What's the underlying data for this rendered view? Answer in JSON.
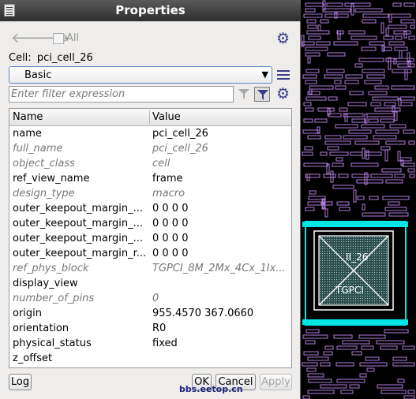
{
  "window": {
    "title": "Properties"
  },
  "toolbar": {
    "back_icon": "arrow-left-icon",
    "forward_icon": "arrow-right-icon",
    "all_label": "All",
    "all_checked": false,
    "settings_icon": "gear-icon"
  },
  "cell": {
    "label": "Cell:",
    "name": "pci_cell_26"
  },
  "view_select": {
    "value": "Basic"
  },
  "filter": {
    "placeholder": "Enter filter expression",
    "value": ""
  },
  "table": {
    "headers": {
      "name": "Name",
      "value": "Value"
    },
    "rows": [
      {
        "name": "name",
        "value": "pci_cell_26",
        "readonly": false
      },
      {
        "name": "full_name",
        "value": "pci_cell_26",
        "readonly": true
      },
      {
        "name": "object_class",
        "value": "cell",
        "readonly": true
      },
      {
        "name": "ref_view_name",
        "value": "frame",
        "readonly": false
      },
      {
        "name": "design_type",
        "value": "macro",
        "readonly": true
      },
      {
        "name": "outer_keepout_margin_...",
        "value": "0 0 0 0",
        "readonly": false
      },
      {
        "name": "outer_keepout_margin_...",
        "value": "0 0 0 0",
        "readonly": false
      },
      {
        "name": "outer_keepout_margin_...",
        "value": "0 0 0 0",
        "readonly": false
      },
      {
        "name": "outer_keepout_margin_r...",
        "value": "0 0 0 0",
        "readonly": false
      },
      {
        "name": "ref_phys_block",
        "value": "TGPCI_8M_2Mx_4Cx_1Ix...",
        "readonly": true
      },
      {
        "name": "display_view",
        "value": "",
        "readonly": false
      },
      {
        "name": "number_of_pins",
        "value": "0",
        "readonly": true
      },
      {
        "name": "origin",
        "value": "955.4570 367.0660",
        "readonly": false
      },
      {
        "name": "orientation",
        "value": "R0",
        "readonly": false
      },
      {
        "name": "physical_status",
        "value": "fixed",
        "readonly": false
      },
      {
        "name": "z_offset",
        "value": "",
        "readonly": false
      }
    ]
  },
  "buttons": {
    "log": "Log",
    "ok": "OK",
    "cancel": "Cancel",
    "apply": "Apply"
  },
  "watermark": "bbs.eetop.cn",
  "layout_view": {
    "cell_label_1": "II_26",
    "cell_label_2": "TGPCI"
  },
  "colors": {
    "wire": "#b07ad8",
    "macro_border": "#00e5e5",
    "macro_fill": "#2f4f4f",
    "dialog_bg": "#eeedeb"
  }
}
